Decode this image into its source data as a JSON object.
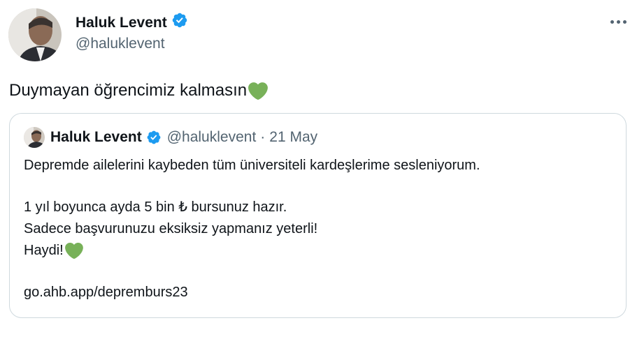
{
  "author": {
    "name": "Haluk Levent",
    "handle": "@haluklevent",
    "verified": true
  },
  "tweet": {
    "text": "Duymayan öğrencimiz kalmasın",
    "emoji": "green-heart"
  },
  "quoted_tweet": {
    "name": "Haluk Levent",
    "handle": "@haluklevent",
    "separator": "·",
    "date": "21 May",
    "lines": {
      "l1": "Depremde ailelerini kaybeden tüm üniversiteli kardeşlerime sesleniyorum.",
      "l2": "1 yıl boyunca ayda 5 bin ₺ bursunuz hazır.",
      "l3": "Sadece başvurunuzu eksiksiz yapmanız yeterli!",
      "l4": "Haydi!",
      "l5": "go.ahb.app/depremburs23"
    }
  },
  "colors": {
    "verified": "#1d9bf0",
    "heart": "#78b159",
    "secondary_text": "#536471",
    "border": "#cfd9de"
  }
}
